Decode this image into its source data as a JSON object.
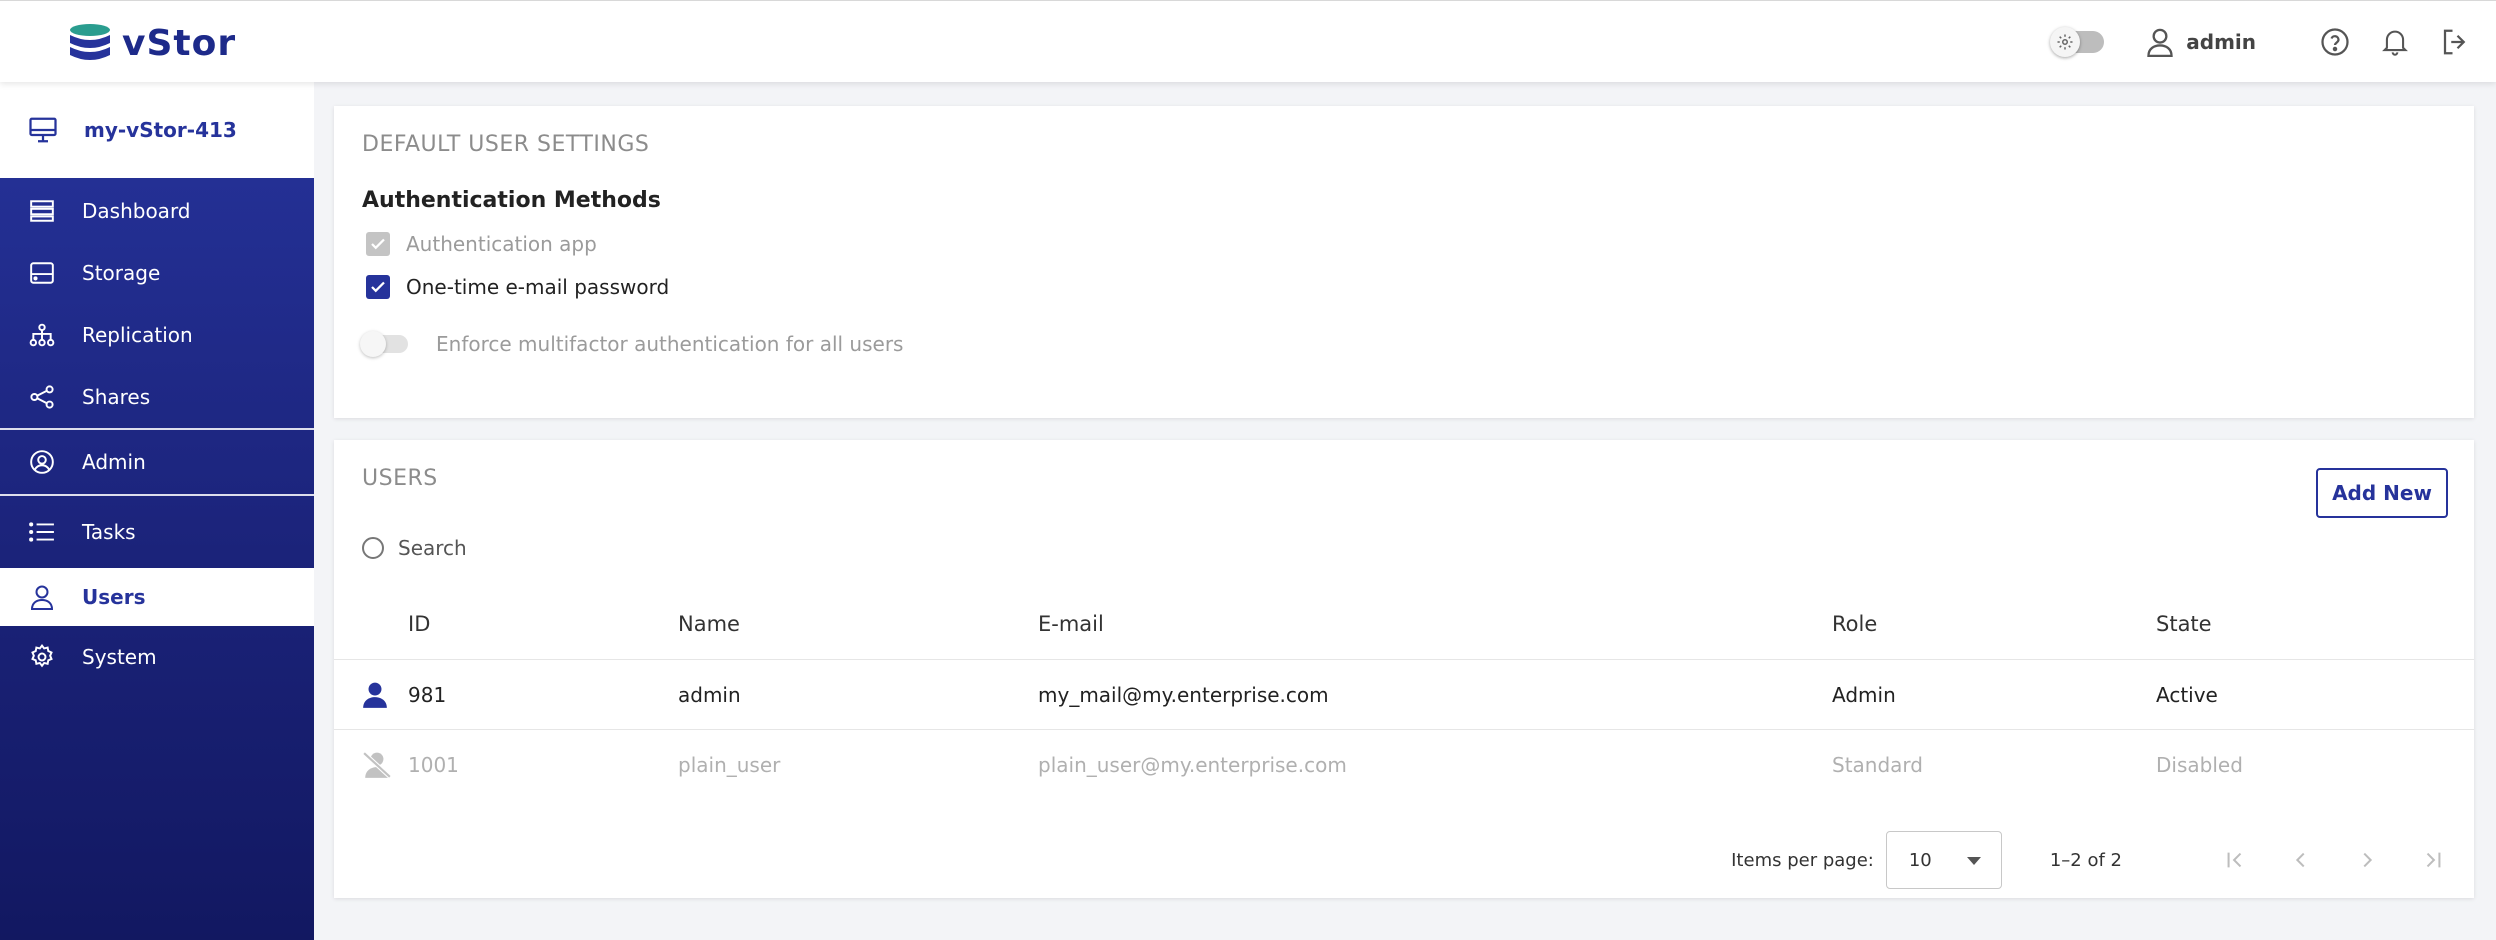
{
  "app": {
    "logo_text": "vStor",
    "brand_color": "#26339b"
  },
  "header": {
    "username": "admin",
    "icons": [
      "theme-toggle",
      "user-icon",
      "help-icon",
      "bell-icon",
      "logout-icon"
    ]
  },
  "sidebar": {
    "device_name": "my-vStor-413",
    "items": [
      {
        "label": "Dashboard",
        "icon": "dashboard-icon"
      },
      {
        "label": "Storage",
        "icon": "storage-icon"
      },
      {
        "label": "Replication",
        "icon": "replication-icon"
      },
      {
        "label": "Shares",
        "icon": "share-icon"
      },
      {
        "label": "Admin",
        "icon": "admin-icon"
      },
      {
        "label": "Tasks",
        "icon": "tasks-icon"
      },
      {
        "label": "Users",
        "icon": "users-icon",
        "active": true
      },
      {
        "label": "System",
        "icon": "gear-icon"
      }
    ]
  },
  "settings": {
    "title": "DEFAULT USER SETTINGS",
    "auth_title": "Authentication Methods",
    "auth_app_label": "Authentication app",
    "otp_label": "One-time e-mail password",
    "enforce_label": "Enforce multifactor authentication for all users"
  },
  "users": {
    "title": "USERS",
    "add_button": "Add New",
    "search_placeholder": "Search",
    "columns": {
      "id": "ID",
      "name": "Name",
      "email": "E-mail",
      "role": "Role",
      "state": "State"
    },
    "rows": [
      {
        "id": "981",
        "name": "admin",
        "email": "my_mail@my.enterprise.com",
        "role": "Admin",
        "state": "Active"
      },
      {
        "id": "1001",
        "name": "plain_user",
        "email": "plain_user@my.enterprise.com",
        "role": "Standard",
        "state": "Disabled"
      }
    ],
    "pager": {
      "items_per_page_label": "Items per page:",
      "items_per_page": "10",
      "range": "1–2 of 2"
    }
  }
}
